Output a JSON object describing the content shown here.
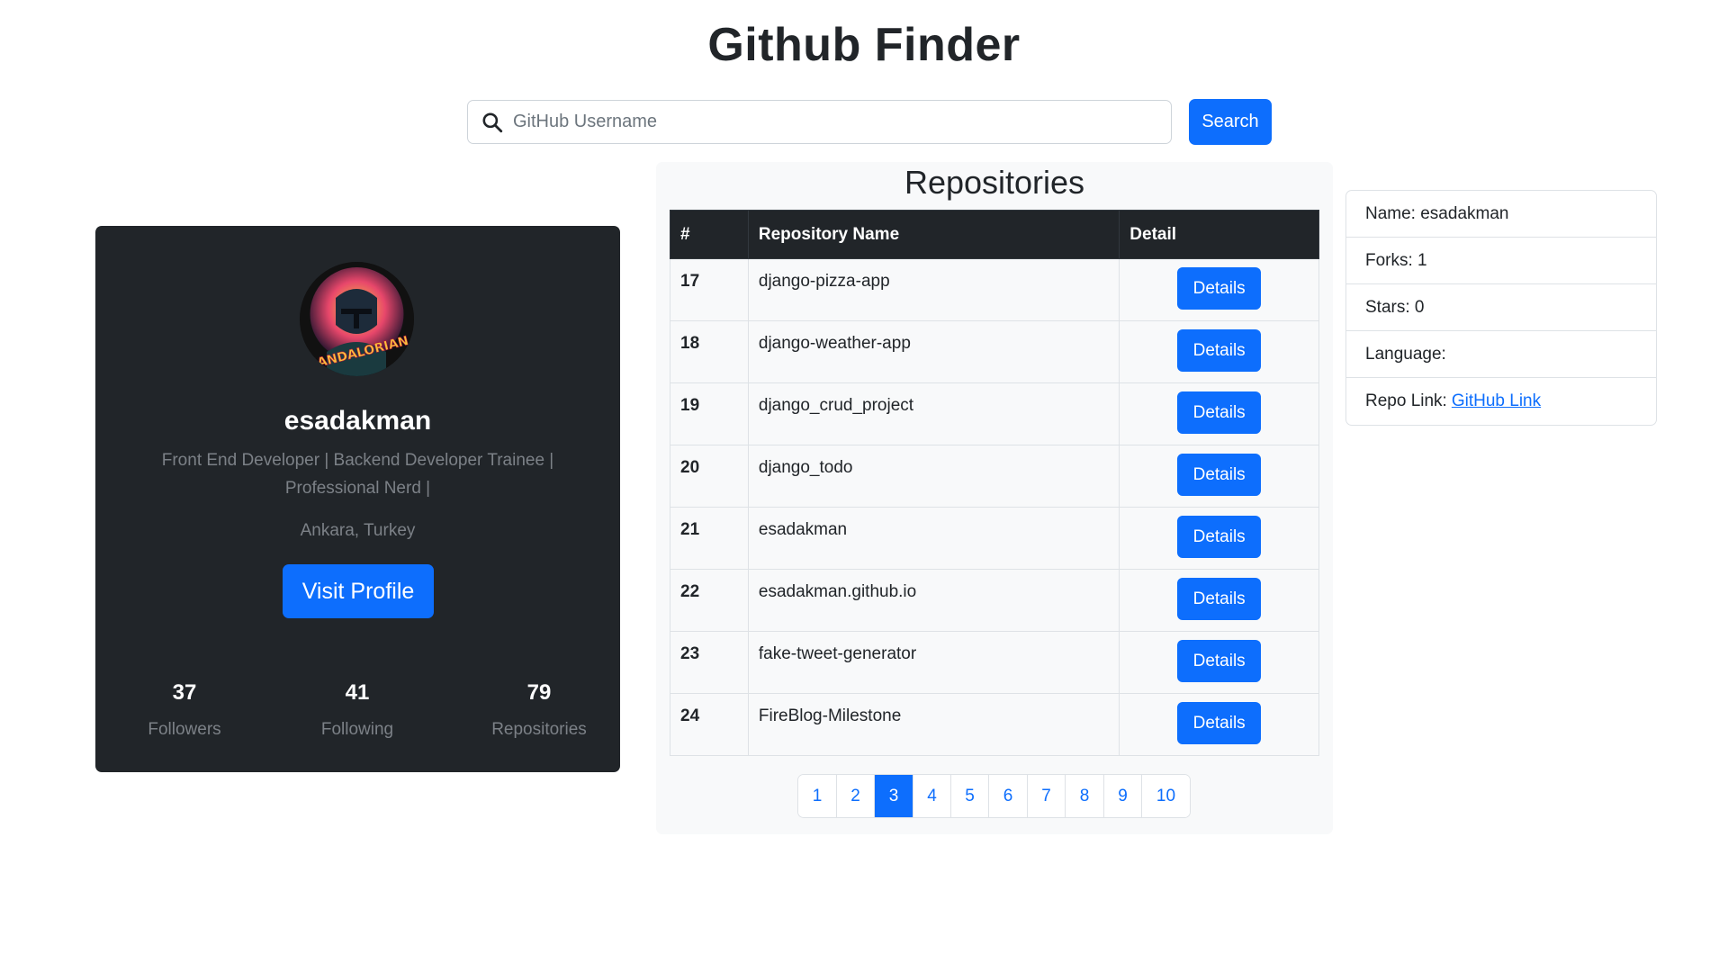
{
  "header": {
    "title": "Github Finder"
  },
  "search": {
    "placeholder": "GitHub Username",
    "value": "",
    "button_label": "Search"
  },
  "profile": {
    "avatar_alt": "MANDALORIAN",
    "username": "esadakman",
    "bio": "Front End Developer | Backend Developer Trainee | Professional Nerd |",
    "location": "Ankara, Turkey",
    "visit_label": "Visit Profile",
    "stats": [
      {
        "value": "37",
        "label": "Followers"
      },
      {
        "value": "41",
        "label": "Following"
      },
      {
        "value": "79",
        "label": "Repositories"
      }
    ]
  },
  "repositories": {
    "title": "Repositories",
    "columns": [
      "#",
      "Repository Name",
      "Detail"
    ],
    "rows": [
      {
        "num": "17",
        "name": "django-pizza-app",
        "action": "Details"
      },
      {
        "num": "18",
        "name": "django-weather-app",
        "action": "Details"
      },
      {
        "num": "19",
        "name": "django_crud_project",
        "action": "Details"
      },
      {
        "num": "20",
        "name": "django_todo",
        "action": "Details"
      },
      {
        "num": "21",
        "name": "esadakman",
        "action": "Details"
      },
      {
        "num": "22",
        "name": "esadakman.github.io",
        "action": "Details"
      },
      {
        "num": "23",
        "name": "fake-tweet-generator",
        "action": "Details"
      },
      {
        "num": "24",
        "name": "FireBlog-Milestone",
        "action": "Details"
      }
    ],
    "pagination": {
      "pages": [
        "1",
        "2",
        "3",
        "4",
        "5",
        "6",
        "7",
        "8",
        "9",
        "10"
      ],
      "active": "3"
    }
  },
  "repo_detail": {
    "name": "Name: esadakman",
    "forks": "Forks: 1",
    "stars": "Stars: 0",
    "language": "Language:",
    "link_prefix": "Repo Link:",
    "link_label": "GitHub Link"
  },
  "colors": {
    "primary": "#0d6efd",
    "dark": "#212529",
    "muted": "#7c8187",
    "panel": "#f8f9fa"
  },
  "icons": {
    "search": "search-icon"
  }
}
